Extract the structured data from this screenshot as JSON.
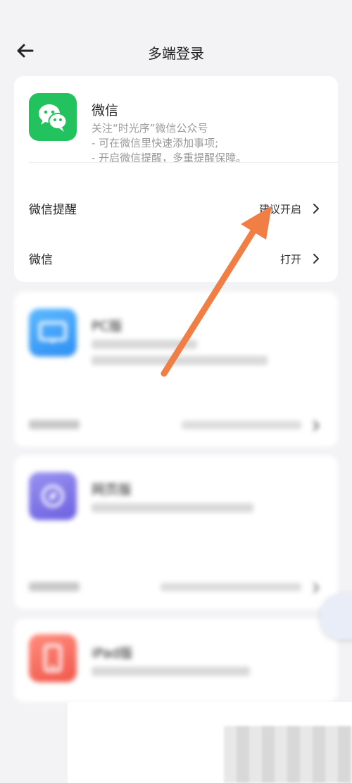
{
  "header": {
    "title": "多端登录"
  },
  "wechat_card": {
    "name": "微信",
    "desc_lines": [
      "关注“时光序”微信公众号",
      "- 可在微信里快速添加事项;",
      "- 开启微信提醒，多重提醒保障。"
    ],
    "rows": [
      {
        "label": "微信提醒",
        "value": "建议开启"
      },
      {
        "label": "微信",
        "value": "打开"
      }
    ]
  },
  "pc_card": {
    "name": "PC版"
  },
  "web_card": {
    "name": "网页版"
  },
  "ipad_card": {
    "name": "iPad版"
  },
  "colors": {
    "wechat_green": "#22c35e",
    "annotation_orange": "#f07e45"
  },
  "icons": {
    "back": "arrow-left-icon",
    "chevron": "chevron-right-icon",
    "wechat": "wechat-logo-icon"
  }
}
